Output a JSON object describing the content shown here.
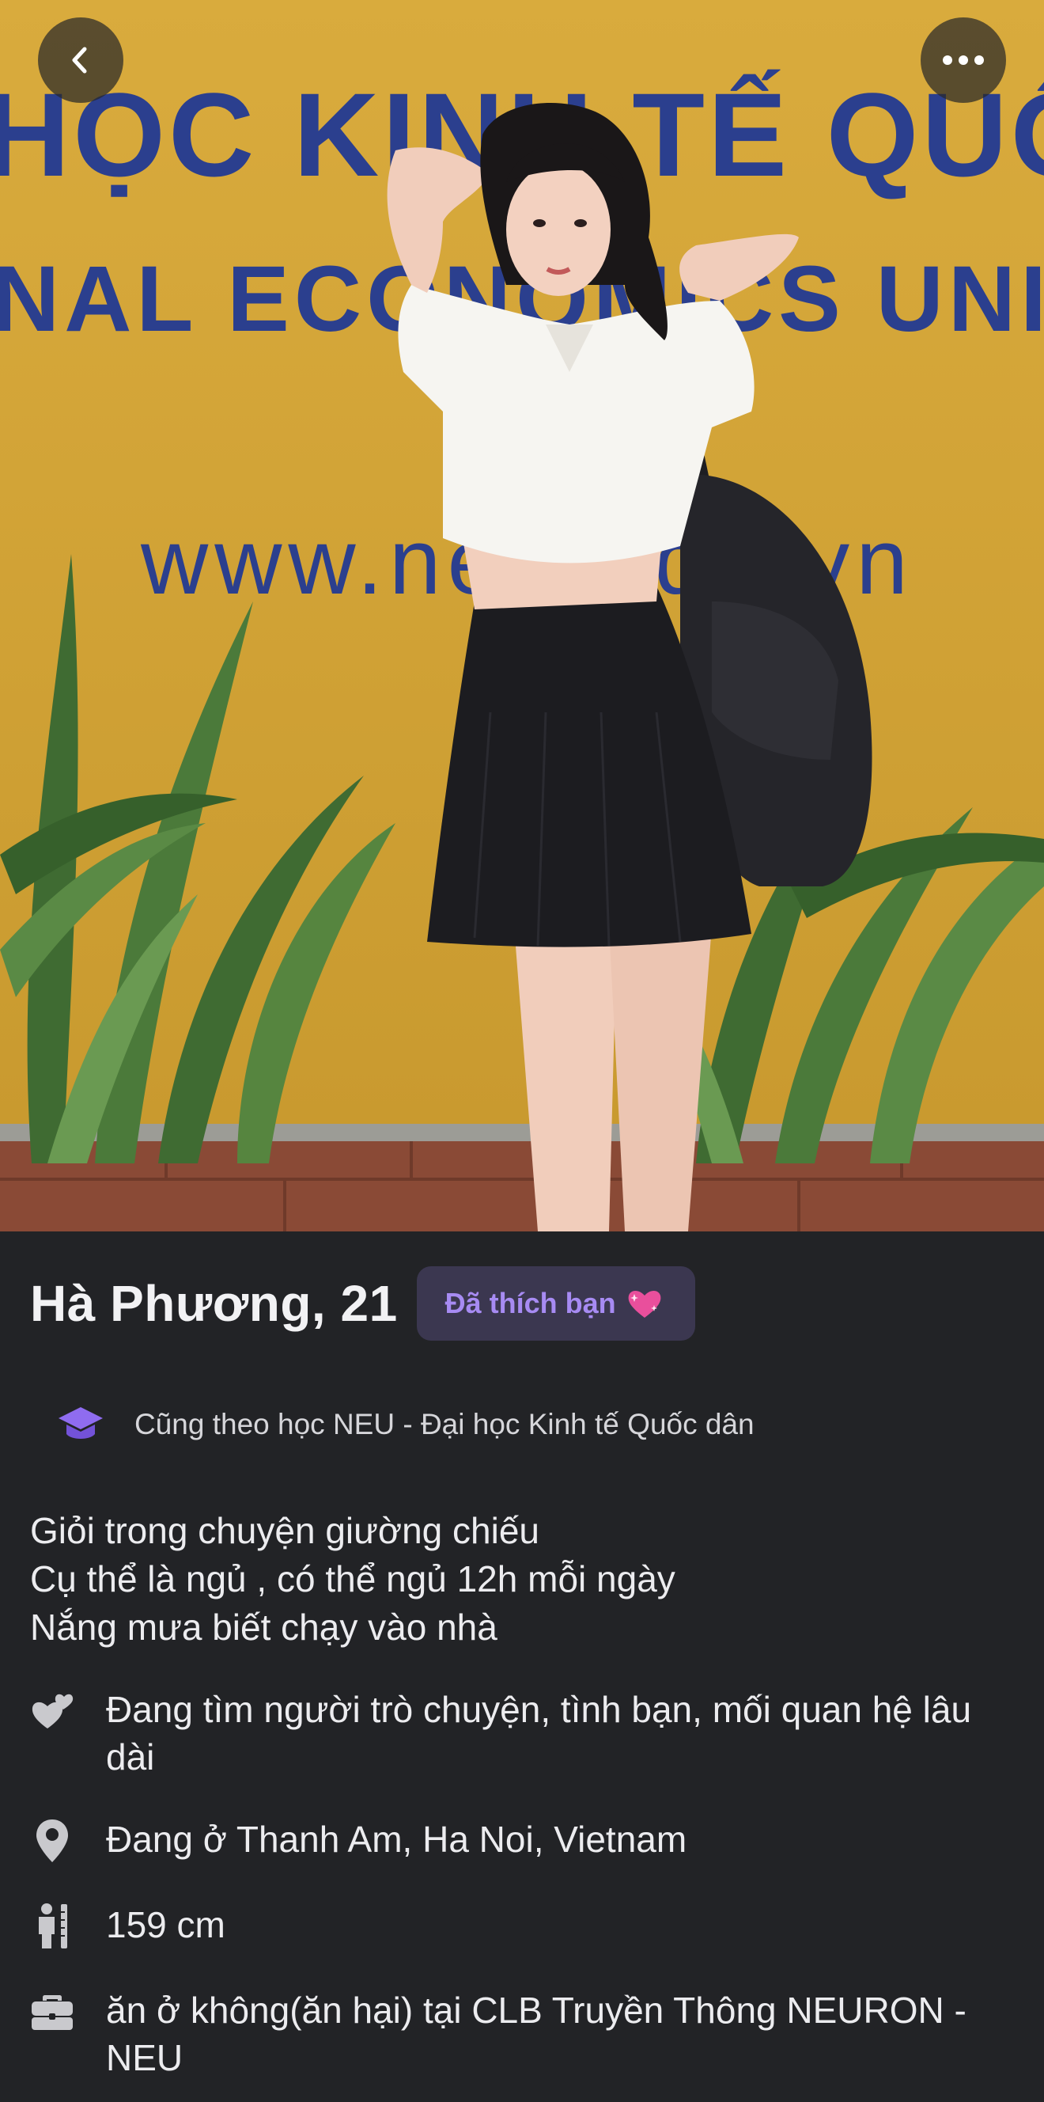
{
  "header": {
    "back_icon": "chevron-left-icon",
    "more_icon": "more-horizontal-icon"
  },
  "photo": {
    "sign_line1": "HỌC KINH TẾ QUỐC D",
    "sign_line2": "NAL ECONOMICS UNIVER",
    "sign_line3": "www.neu.edu.vn"
  },
  "profile": {
    "name_age": "Hà Phương, 21",
    "liked_badge": "Đã thích bạn",
    "liked_icon": "sparkling-heart-icon",
    "school": "Cũng theo học NEU - Đại học Kinh tế Quốc dân",
    "bio": [
      "Giỏi trong chuyện giường chiếu",
      "Cụ thể là ngủ , có thể ngủ 12h mỗi ngày",
      "Nắng mưa biết chạy vào nhà"
    ],
    "looking_for": "Đang tìm người trò chuyện, tình bạn, mối quan hệ lâu dài",
    "location": "Đang ở Thanh Am, Ha Noi, Vietnam",
    "height": "159 cm",
    "work": "ăn ở không(ăn hại) tại CLB Truyền Thông NEURON - NEU"
  },
  "colors": {
    "background": "#222326",
    "badge_bg": "#3b3750",
    "accent_purple": "#a78bf3",
    "text": "#ececef",
    "icon_gray": "#c9c9cd"
  }
}
